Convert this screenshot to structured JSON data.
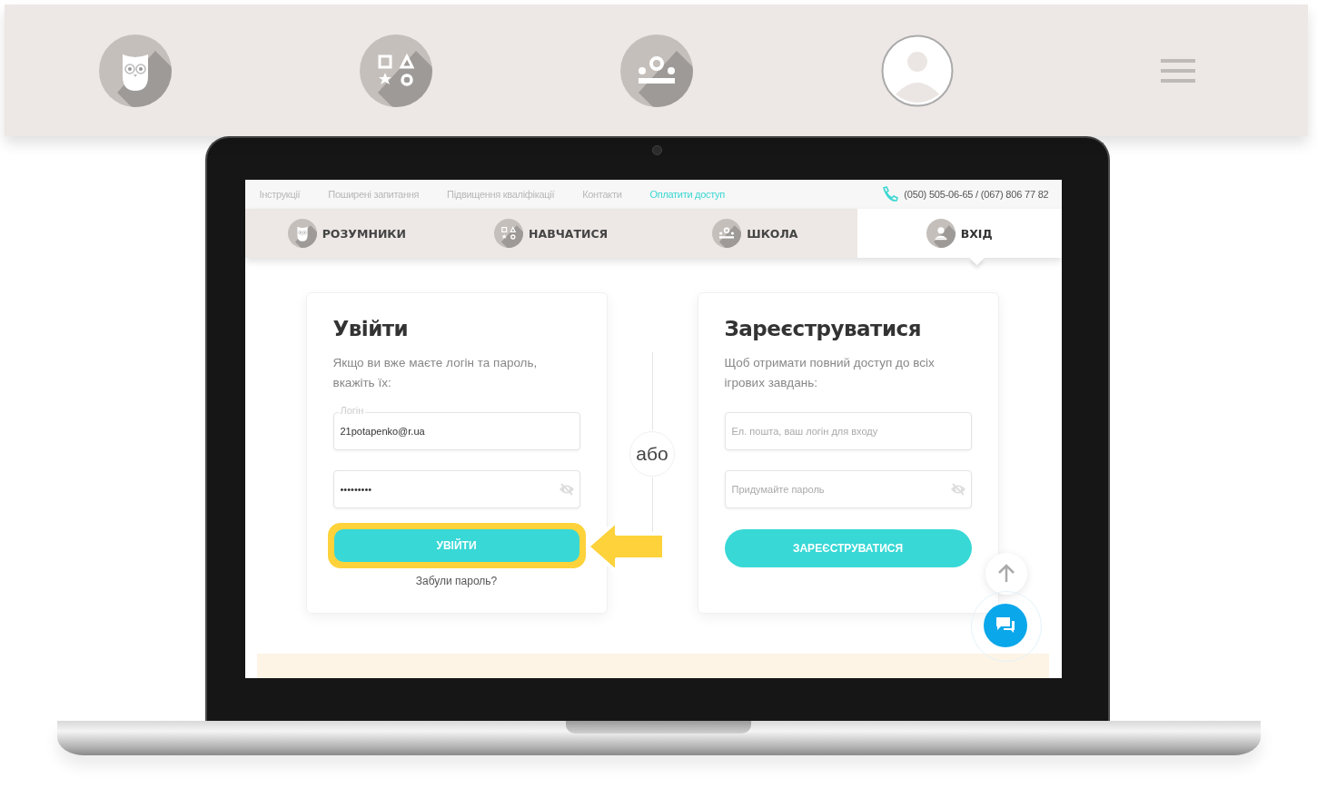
{
  "app_bar": {
    "items": [
      {
        "kind": "owl"
      },
      {
        "kind": "shapes"
      },
      {
        "kind": "school"
      },
      {
        "kind": "user"
      },
      {
        "kind": "menu"
      }
    ]
  },
  "screen": {
    "top_links": [
      {
        "label": "Інструкції",
        "kind": "plain"
      },
      {
        "label": "Поширені запитання",
        "kind": "plain"
      },
      {
        "label": "Підвищення кваліфікації",
        "kind": "plain"
      },
      {
        "label": "Контакти",
        "kind": "plain"
      },
      {
        "label": "Оплатити доступ",
        "kind": "accent"
      }
    ],
    "phone": "(050) 505-06-65 / (067) 806 77 82",
    "tabs": [
      {
        "label": "РОЗУМНИКИ",
        "selected": false
      },
      {
        "label": "НАВЧАТИСЯ",
        "selected": false
      },
      {
        "label": "ШКОЛА",
        "selected": false
      },
      {
        "label": "ВХІД",
        "selected": true
      }
    ],
    "login": {
      "title": "Увійти",
      "subtitle": "Якщо ви вже маєте логін та пароль, вкажіть їх:",
      "fields": [
        {
          "kind": "text",
          "label": "Логін",
          "value": "21potapenko@r.ua"
        },
        {
          "kind": "password",
          "value": "•••••••••"
        }
      ],
      "button": {
        "label": "УВІЙТИ",
        "highlighted": true
      },
      "forgot_link": "Забули пароль?"
    },
    "divider": "або",
    "register": {
      "title": "Зареєструватися",
      "subtitle": "Щоб отримати повний доступ до всіх ігрових завдань:",
      "fields": [
        {
          "kind": "text",
          "placeholder": "Ел. пошта, ваш логін для входу"
        },
        {
          "kind": "password",
          "placeholder": "Придумайте пароль"
        }
      ],
      "button": {
        "label": "ЗАРЕЄСТРУВАТИСЯ",
        "highlighted": false
      }
    }
  }
}
